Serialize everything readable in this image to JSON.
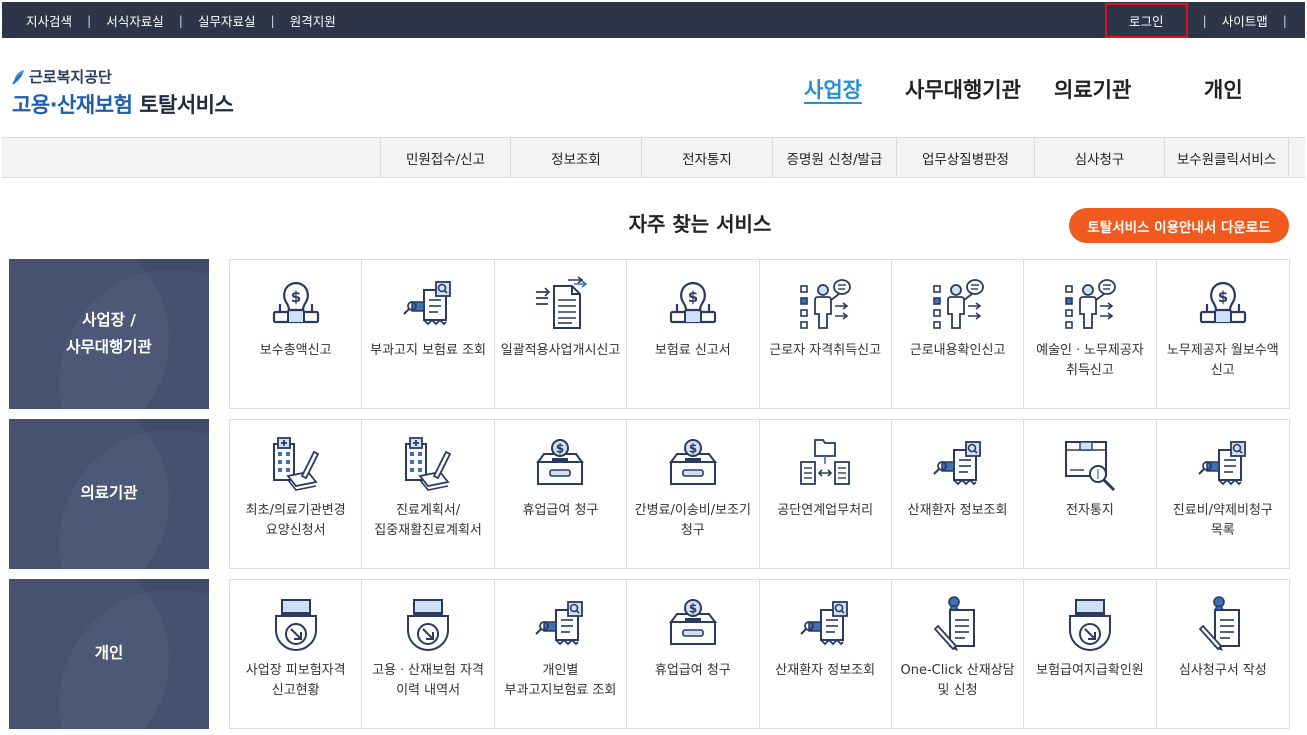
{
  "topbar": {
    "left_links": [
      "지사검색",
      "서식자료실",
      "실무자료실",
      "원격지원"
    ],
    "login": "로그인",
    "sitemap": "사이트맵",
    "separator": "|"
  },
  "header": {
    "org_name": "근로복지공단",
    "service_blue": "고용·산재보험",
    "service_dark": "토탈서비스",
    "nav": [
      "사업장",
      "사무대행기관",
      "의료기관",
      "개인"
    ],
    "active_nav": "사업장"
  },
  "subnav": [
    "민원접수/신고",
    "정보조회",
    "전자통지",
    "증명원 신청/발급",
    "업무상질병판정",
    "심사청구",
    "보수원클릭서비스"
  ],
  "section": {
    "title": "자주 찾는 서비스",
    "download_button": "토탈서비스 이용안내서 다운로드"
  },
  "rows": [
    {
      "label": "사업장 /\n사무대행기관",
      "items": [
        {
          "icon": "money-laptop-icon",
          "text": "보수총액신고"
        },
        {
          "icon": "search-document-icon",
          "text": "부과고지 보험료 조회"
        },
        {
          "icon": "document-transfer-icon",
          "text": "일괄적용사업개시신고"
        },
        {
          "icon": "money-laptop-icon",
          "text": "보험료 신고서"
        },
        {
          "icon": "person-checklist-icon",
          "text": "근로자 자격취득신고"
        },
        {
          "icon": "person-checklist-icon",
          "text": "근로내용확인신고"
        },
        {
          "icon": "person-checklist-icon",
          "text": "예술인ㆍ노무제공자 취득신고"
        },
        {
          "icon": "money-laptop-icon",
          "text": "노무제공자 월보수액 신고"
        }
      ]
    },
    {
      "label": "의료기관",
      "items": [
        {
          "icon": "hospital-pen-icon",
          "text": "최초/의료기관변경 요양신청서"
        },
        {
          "icon": "hospital-pen-icon",
          "text": "진료계획서/집중재활진료계획서"
        },
        {
          "icon": "money-box-icon",
          "text": "휴업급여 청구"
        },
        {
          "icon": "money-box-icon",
          "text": "간병료/이송비/보조기 청구"
        },
        {
          "icon": "folder-exchange-icon",
          "text": "공단연계업무처리"
        },
        {
          "icon": "search-document-icon",
          "text": "산재환자 정보조회"
        },
        {
          "icon": "box-magnifier-icon",
          "text": "전자통지"
        },
        {
          "icon": "search-document-icon",
          "text": "진료비/약제비청구 목록"
        }
      ]
    },
    {
      "label": "개인",
      "items": [
        {
          "icon": "printer-download-icon",
          "text": "사업장 피보험자격 신고현황"
        },
        {
          "icon": "printer-download-icon",
          "text": "고용ㆍ산재보험 자격 이력 내역서"
        },
        {
          "icon": "search-document-icon",
          "text": "개인별 부과고지보험료 조회"
        },
        {
          "icon": "money-box-icon",
          "text": "휴업급여 청구"
        },
        {
          "icon": "search-document-icon",
          "text": "산재환자 정보조회"
        },
        {
          "icon": "pin-document-pen-icon",
          "text": "One-Click 산재상담 및 신청"
        },
        {
          "icon": "printer-download-icon",
          "text": "보험급여지급확인원"
        },
        {
          "icon": "pin-document-pen-icon",
          "text": "심사청구서 작성"
        }
      ]
    }
  ],
  "colors": {
    "topbar": "#2d3548",
    "row_label": "#3f4b6b",
    "accent_orange": "#f05a1e",
    "active_nav": "#2a8fcf",
    "icon_navy": "#2b3a5e",
    "icon_blue": "#3f6fb5",
    "login_highlight": "#e0121e"
  }
}
